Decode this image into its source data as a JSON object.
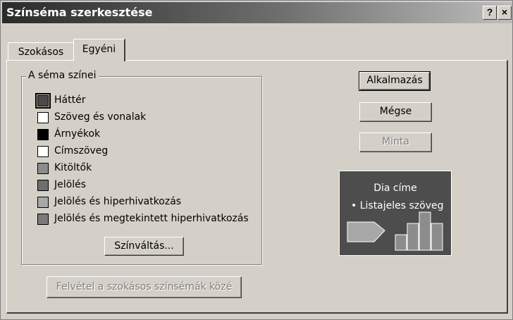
{
  "window": {
    "title": "Színséma szerkesztése",
    "help_button": "?",
    "close_button": "×"
  },
  "tabs": [
    {
      "label": "Szokásos",
      "active": false
    },
    {
      "label": "Egyéni",
      "active": true
    }
  ],
  "scheme_group": {
    "label": "A séma színei",
    "items": [
      {
        "label": "Háttér",
        "color": "#4a4a4a",
        "selected": true
      },
      {
        "label": "Szöveg és vonalak",
        "color": "#ffffff",
        "selected": false
      },
      {
        "label": "Árnyékok",
        "color": "#000000",
        "selected": false
      },
      {
        "label": "Címszöveg",
        "color": "#ffffff",
        "selected": false
      },
      {
        "label": "Kitöltők",
        "color": "#8c8c8c",
        "selected": false
      },
      {
        "label": "Jelölés",
        "color": "#6e6e6e",
        "selected": false
      },
      {
        "label": "Jelölés és hiperhivatkozás",
        "color": "#a8a8a8",
        "selected": false
      },
      {
        "label": "Jelölés és megtekintett hiperhivatkozás",
        "color": "#7a7a7a",
        "selected": false
      }
    ],
    "change_color_button": "Színváltás..."
  },
  "add_to_standard_button": "Felvétel a szokásos színsémák közé",
  "buttons": {
    "apply": "Alkalmazás",
    "cancel": "Mégse",
    "preview": "Minta"
  },
  "preview_pane": {
    "title": "Dia címe",
    "bullet": "• Listajeles szöveg",
    "bar_values": [
      1,
      2,
      3,
      2
    ]
  }
}
